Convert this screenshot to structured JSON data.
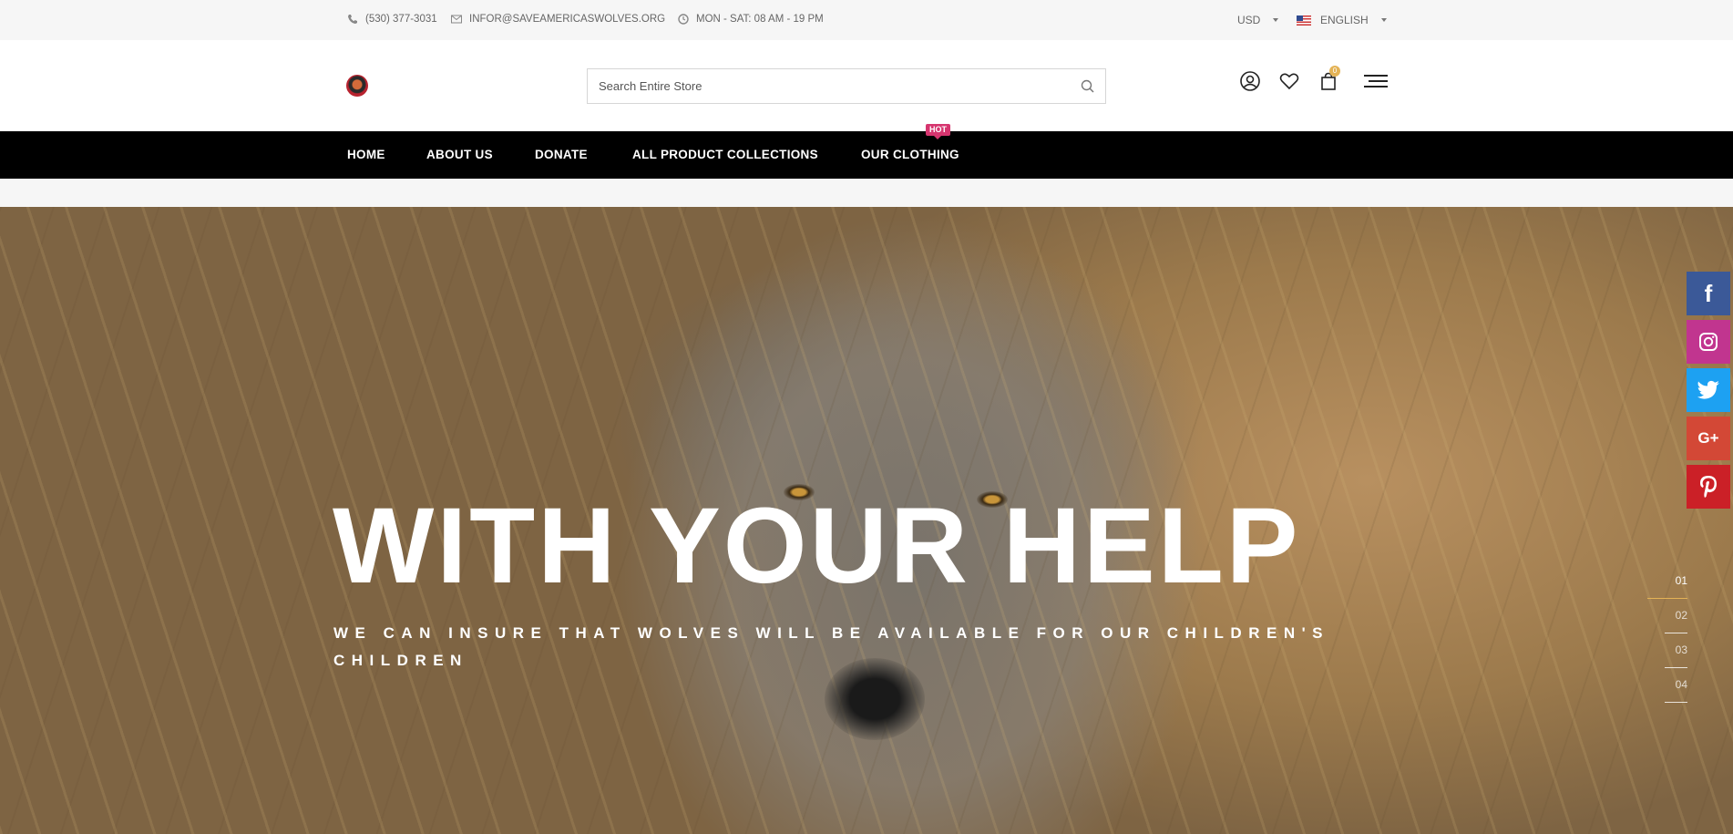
{
  "topbar": {
    "phone": "(530) 377-3031",
    "email": "INFOR@SAVEAMERICASWOLVES.ORG",
    "hours": "MON - SAT: 08 AM - 19 PM",
    "currency": "USD",
    "language": "ENGLISH"
  },
  "header": {
    "search_placeholder": "Search Entire Store",
    "cart_count": "0"
  },
  "nav": {
    "items": [
      "HOME",
      "ABOUT US",
      "DONATE",
      "ALL PRODUCT COLLECTIONS",
      "OUR CLOTHING"
    ],
    "hot_badge": "HOT"
  },
  "hero": {
    "title": "WITH YOUR HELP",
    "subtitle": "WE CAN INSURE THAT WOLVES WILL BE AVAILABLE FOR OUR CHILDREN'S CHILDREN"
  },
  "social": [
    {
      "name": "facebook",
      "glyph": "f",
      "color": "#3b5998"
    },
    {
      "name": "instagram",
      "glyph": "◎",
      "color": "#c1358f"
    },
    {
      "name": "twitter",
      "glyph": "🐦",
      "color": "#1da1f2"
    },
    {
      "name": "google-plus",
      "glyph": "G+",
      "color": "#d34836"
    },
    {
      "name": "pinterest",
      "glyph": "P",
      "color": "#cb2027"
    }
  ],
  "pager": [
    "01",
    "02",
    "03",
    "04"
  ]
}
